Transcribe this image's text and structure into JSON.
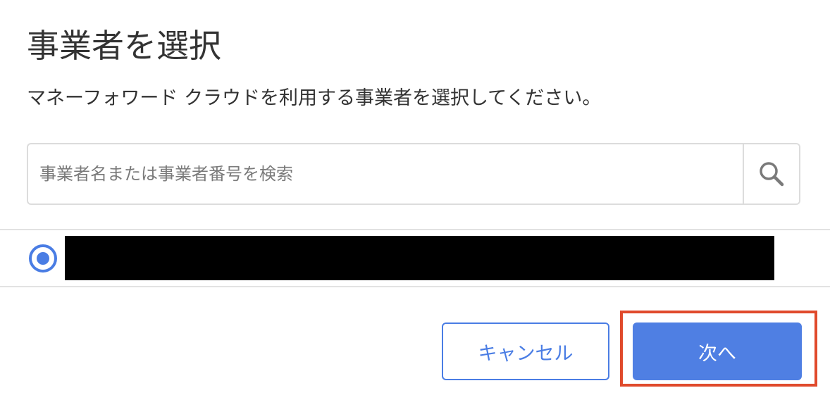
{
  "dialog": {
    "title": "事業者を選択",
    "description": "マネーフォワード クラウドを利用する事業者を選択してください。"
  },
  "search": {
    "placeholder": "事業者名または事業者番号を検索",
    "value": "",
    "button_icon": "search-icon"
  },
  "business_list": {
    "items": [
      {
        "name": "",
        "selected": true,
        "redacted": true
      }
    ]
  },
  "footer": {
    "cancel_label": "キャンセル",
    "next_label": "次へ"
  },
  "colors": {
    "accent": "#4a7de4",
    "primary_button": "#4f7fe3",
    "highlight": "#e04a2c",
    "border": "#dcdcdc"
  }
}
